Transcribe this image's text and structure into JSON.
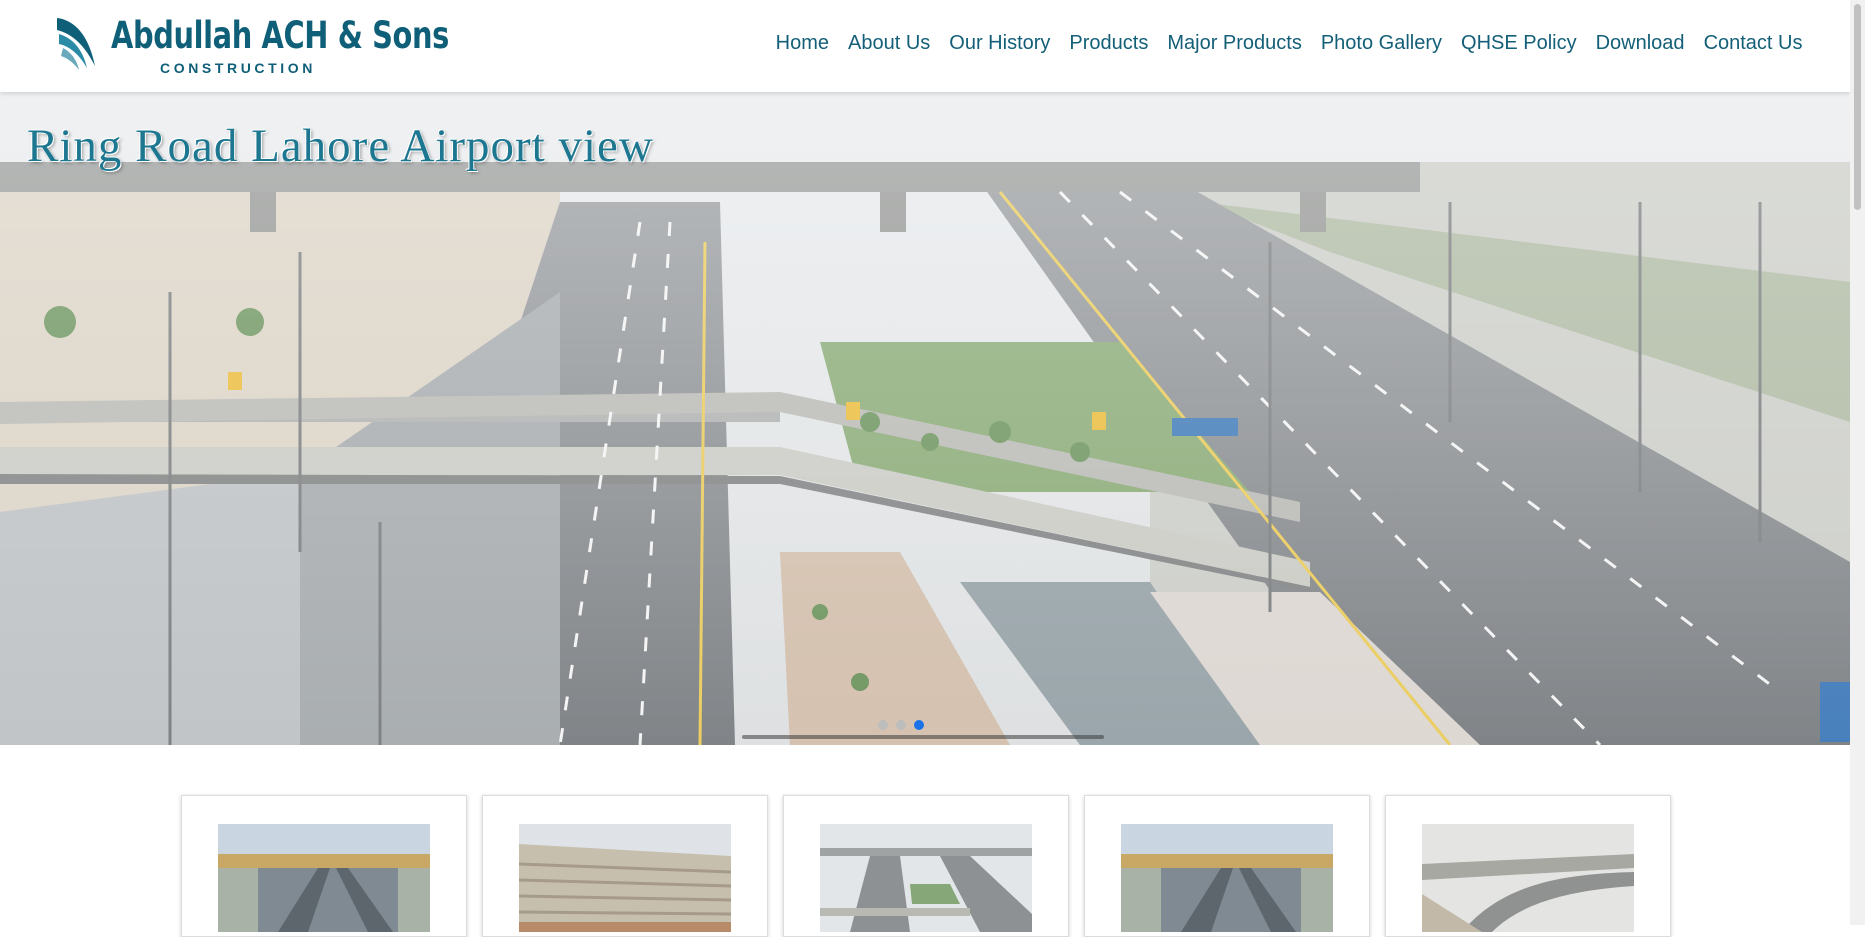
{
  "brand": {
    "name": "Abdullah ACH & Sons",
    "subtitle": "CONSTRUCTION",
    "primary_color": "#0f5f78",
    "logo_icon": "swoosh-logo-icon"
  },
  "nav": {
    "items": [
      {
        "label": "Home"
      },
      {
        "label": "About Us"
      },
      {
        "label": "Our History"
      },
      {
        "label": "Products"
      },
      {
        "label": "Major Products"
      },
      {
        "label": "Photo Gallery"
      },
      {
        "label": "QHSE Policy"
      },
      {
        "label": "Download"
      },
      {
        "label": "Contact Us"
      }
    ]
  },
  "hero": {
    "caption": "Ring Road Lahore Airport view",
    "slide_count": 3,
    "active_slide": 3,
    "indicator_active_color": "#1a73e8"
  },
  "gallery": {
    "cards": [
      {
        "image": "flyover-road-photo"
      },
      {
        "image": "building-facade-photo"
      },
      {
        "image": "ring-road-airport-photo"
      },
      {
        "image": "flyover-road-photo"
      },
      {
        "image": "interchange-overpass-photo"
      }
    ]
  }
}
